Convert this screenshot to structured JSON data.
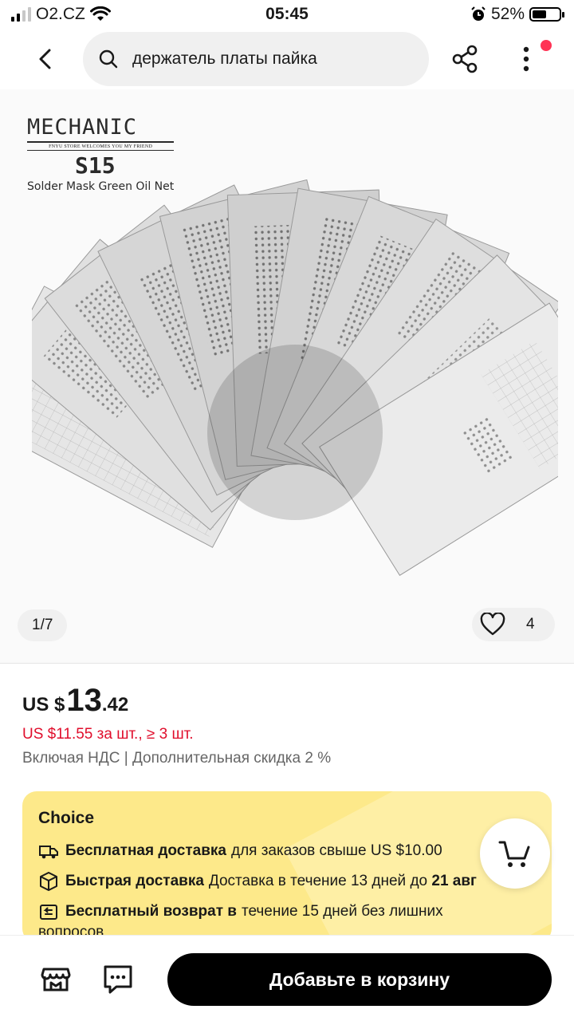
{
  "status_bar": {
    "carrier": "O2.CZ",
    "time": "05:45",
    "battery": "52%",
    "battery_level": 0.52,
    "icons": [
      "signal-icon",
      "wifi-icon",
      "alarm-icon",
      "battery-icon"
    ]
  },
  "header": {
    "search_query": "держатель платы пайка",
    "icons": [
      "back-icon",
      "search-icon",
      "share-icon",
      "more-icon"
    ]
  },
  "gallery": {
    "brand_name": "MECHANIC",
    "brand_tagline": "FNYU STORE WELCOMES YOU MY FRIEND",
    "model": "S15",
    "description": "Solder Mask Green Oil Net",
    "pager": "1/7",
    "wishlist_count": "4"
  },
  "price": {
    "currency": "US $",
    "integer": "13",
    "decimal": ".42",
    "bulk_price": "US $11.55 за шт., ≥ 3 шт.",
    "vat_note": "Включая НДС | Дополнительная скидка 2 %"
  },
  "choice": {
    "title": "Choice",
    "rows": [
      {
        "icon": "truck-icon",
        "bold": "Бесплатная доставка",
        "text": "для заказов свыше US $10.00"
      },
      {
        "icon": "box-icon",
        "bold": "Быстрая доставка",
        "text": "Доставка в течение 13 дней до",
        "text_bold": "21 авг"
      },
      {
        "icon": "return-icon",
        "bold": "Бесплатный возврат в",
        "text": "течение 15 дней без лишних",
        "text_line2": "вопросов"
      }
    ],
    "colors": {
      "background": "#fde98a"
    }
  },
  "bottom_bar": {
    "add_to_cart": "Добавьте в корзину",
    "icons": [
      "store-icon",
      "message-icon"
    ]
  },
  "colors": {
    "accent_red": "#e00e2c",
    "notification_dot": "#ff3355",
    "button_black": "#000000"
  }
}
